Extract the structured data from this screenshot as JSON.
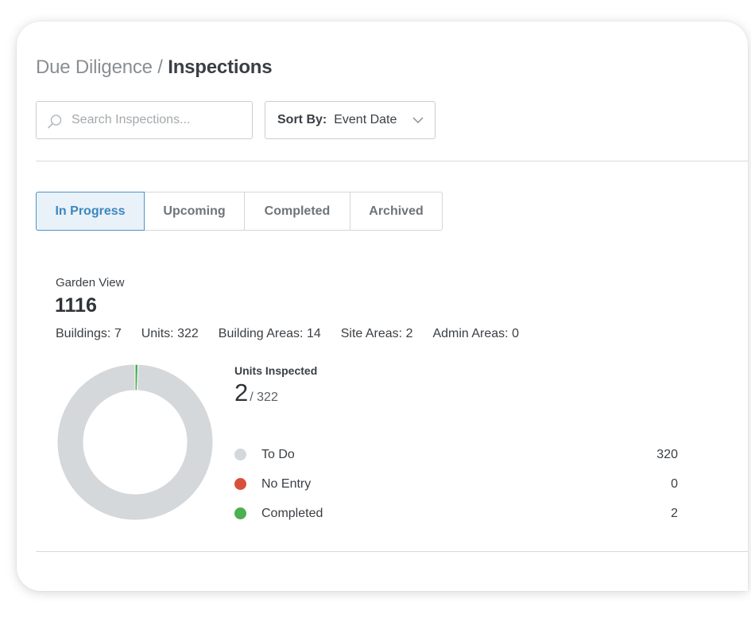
{
  "breadcrumb": {
    "parent": "Due Diligence",
    "separator": "/",
    "current": "Inspections"
  },
  "search": {
    "placeholder": "Search Inspections...",
    "value": ""
  },
  "sort": {
    "label": "Sort By:",
    "value": "Event Date"
  },
  "tabs": [
    {
      "label": "In Progress",
      "active": true
    },
    {
      "label": "Upcoming",
      "active": false
    },
    {
      "label": "Completed",
      "active": false
    },
    {
      "label": "Archived",
      "active": false
    }
  ],
  "property": {
    "name": "Garden View",
    "code": "1116",
    "stats": [
      "Buildings: 7",
      "Units: 322",
      "Building Areas: 14",
      "Site Areas: 2",
      "Admin Areas: 0"
    ]
  },
  "summary": {
    "label": "Units Inspected",
    "count": "2",
    "total": "/ 322"
  },
  "chart_data": {
    "type": "pie",
    "series": [
      {
        "name": "To Do",
        "value": 320,
        "color": "#d4d8db"
      },
      {
        "name": "No Entry",
        "value": 0,
        "color": "#d9503a"
      },
      {
        "name": "Completed",
        "value": 2,
        "color": "#4caf50"
      }
    ]
  },
  "legend": [
    {
      "label": "To Do",
      "value": "320",
      "color": "#d4d8db"
    },
    {
      "label": "No Entry",
      "value": "0",
      "color": "#d9503a"
    },
    {
      "label": "Completed",
      "value": "2",
      "color": "#4caf50"
    }
  ],
  "icons": {
    "search": "search-icon",
    "sort_dropdown": "chevron-down-icon"
  },
  "colors": {
    "accent": "#3d87bd",
    "tab_active_bg": "#e9f2f9"
  }
}
